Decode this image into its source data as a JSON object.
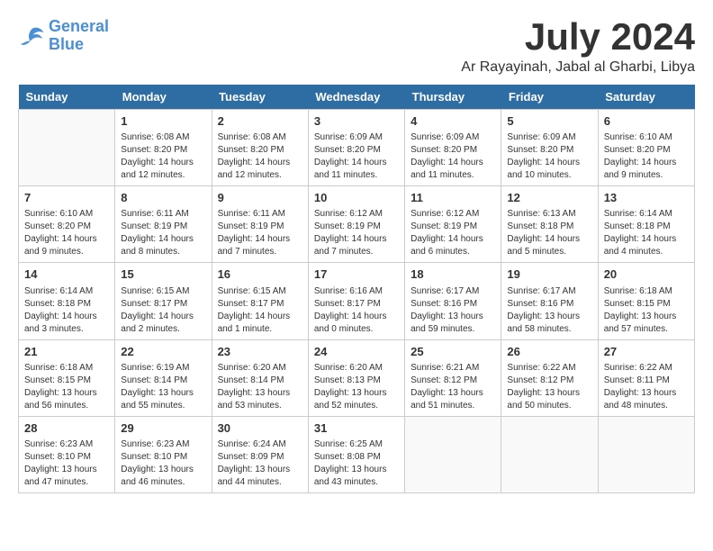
{
  "logo": {
    "line1": "General",
    "line2": "Blue"
  },
  "title": "July 2024",
  "location": "Ar Rayayinah, Jabal al Gharbi, Libya",
  "weekdays": [
    "Sunday",
    "Monday",
    "Tuesday",
    "Wednesday",
    "Thursday",
    "Friday",
    "Saturday"
  ],
  "weeks": [
    [
      {
        "day": "",
        "info": ""
      },
      {
        "day": "1",
        "info": "Sunrise: 6:08 AM\nSunset: 8:20 PM\nDaylight: 14 hours\nand 12 minutes."
      },
      {
        "day": "2",
        "info": "Sunrise: 6:08 AM\nSunset: 8:20 PM\nDaylight: 14 hours\nand 12 minutes."
      },
      {
        "day": "3",
        "info": "Sunrise: 6:09 AM\nSunset: 8:20 PM\nDaylight: 14 hours\nand 11 minutes."
      },
      {
        "day": "4",
        "info": "Sunrise: 6:09 AM\nSunset: 8:20 PM\nDaylight: 14 hours\nand 11 minutes."
      },
      {
        "day": "5",
        "info": "Sunrise: 6:09 AM\nSunset: 8:20 PM\nDaylight: 14 hours\nand 10 minutes."
      },
      {
        "day": "6",
        "info": "Sunrise: 6:10 AM\nSunset: 8:20 PM\nDaylight: 14 hours\nand 9 minutes."
      }
    ],
    [
      {
        "day": "7",
        "info": "Sunrise: 6:10 AM\nSunset: 8:20 PM\nDaylight: 14 hours\nand 9 minutes."
      },
      {
        "day": "8",
        "info": "Sunrise: 6:11 AM\nSunset: 8:19 PM\nDaylight: 14 hours\nand 8 minutes."
      },
      {
        "day": "9",
        "info": "Sunrise: 6:11 AM\nSunset: 8:19 PM\nDaylight: 14 hours\nand 7 minutes."
      },
      {
        "day": "10",
        "info": "Sunrise: 6:12 AM\nSunset: 8:19 PM\nDaylight: 14 hours\nand 7 minutes."
      },
      {
        "day": "11",
        "info": "Sunrise: 6:12 AM\nSunset: 8:19 PM\nDaylight: 14 hours\nand 6 minutes."
      },
      {
        "day": "12",
        "info": "Sunrise: 6:13 AM\nSunset: 8:18 PM\nDaylight: 14 hours\nand 5 minutes."
      },
      {
        "day": "13",
        "info": "Sunrise: 6:14 AM\nSunset: 8:18 PM\nDaylight: 14 hours\nand 4 minutes."
      }
    ],
    [
      {
        "day": "14",
        "info": "Sunrise: 6:14 AM\nSunset: 8:18 PM\nDaylight: 14 hours\nand 3 minutes."
      },
      {
        "day": "15",
        "info": "Sunrise: 6:15 AM\nSunset: 8:17 PM\nDaylight: 14 hours\nand 2 minutes."
      },
      {
        "day": "16",
        "info": "Sunrise: 6:15 AM\nSunset: 8:17 PM\nDaylight: 14 hours\nand 1 minute."
      },
      {
        "day": "17",
        "info": "Sunrise: 6:16 AM\nSunset: 8:17 PM\nDaylight: 14 hours\nand 0 minutes."
      },
      {
        "day": "18",
        "info": "Sunrise: 6:17 AM\nSunset: 8:16 PM\nDaylight: 13 hours\nand 59 minutes."
      },
      {
        "day": "19",
        "info": "Sunrise: 6:17 AM\nSunset: 8:16 PM\nDaylight: 13 hours\nand 58 minutes."
      },
      {
        "day": "20",
        "info": "Sunrise: 6:18 AM\nSunset: 8:15 PM\nDaylight: 13 hours\nand 57 minutes."
      }
    ],
    [
      {
        "day": "21",
        "info": "Sunrise: 6:18 AM\nSunset: 8:15 PM\nDaylight: 13 hours\nand 56 minutes."
      },
      {
        "day": "22",
        "info": "Sunrise: 6:19 AM\nSunset: 8:14 PM\nDaylight: 13 hours\nand 55 minutes."
      },
      {
        "day": "23",
        "info": "Sunrise: 6:20 AM\nSunset: 8:14 PM\nDaylight: 13 hours\nand 53 minutes."
      },
      {
        "day": "24",
        "info": "Sunrise: 6:20 AM\nSunset: 8:13 PM\nDaylight: 13 hours\nand 52 minutes."
      },
      {
        "day": "25",
        "info": "Sunrise: 6:21 AM\nSunset: 8:12 PM\nDaylight: 13 hours\nand 51 minutes."
      },
      {
        "day": "26",
        "info": "Sunrise: 6:22 AM\nSunset: 8:12 PM\nDaylight: 13 hours\nand 50 minutes."
      },
      {
        "day": "27",
        "info": "Sunrise: 6:22 AM\nSunset: 8:11 PM\nDaylight: 13 hours\nand 48 minutes."
      }
    ],
    [
      {
        "day": "28",
        "info": "Sunrise: 6:23 AM\nSunset: 8:10 PM\nDaylight: 13 hours\nand 47 minutes."
      },
      {
        "day": "29",
        "info": "Sunrise: 6:23 AM\nSunset: 8:10 PM\nDaylight: 13 hours\nand 46 minutes."
      },
      {
        "day": "30",
        "info": "Sunrise: 6:24 AM\nSunset: 8:09 PM\nDaylight: 13 hours\nand 44 minutes."
      },
      {
        "day": "31",
        "info": "Sunrise: 6:25 AM\nSunset: 8:08 PM\nDaylight: 13 hours\nand 43 minutes."
      },
      {
        "day": "",
        "info": ""
      },
      {
        "day": "",
        "info": ""
      },
      {
        "day": "",
        "info": ""
      }
    ]
  ]
}
